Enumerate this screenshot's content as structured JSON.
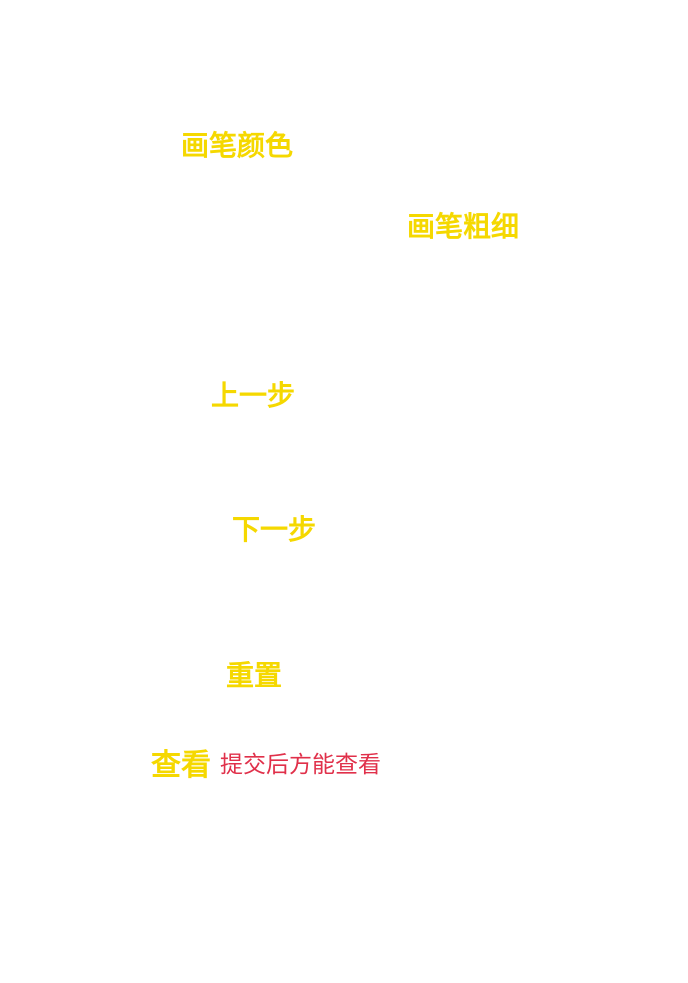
{
  "toolbar": {
    "brush_color_label": "画笔颜色",
    "brush_size_label": "画笔粗细",
    "undo_label": "上一步",
    "redo_label": "下一步",
    "reset_label": "重置",
    "view_label": "查看"
  },
  "notice": {
    "view_hint": "提交后方能查看"
  },
  "colors": {
    "label": "#f5d800",
    "hint": "#e0304a",
    "background": "#ffffff"
  }
}
